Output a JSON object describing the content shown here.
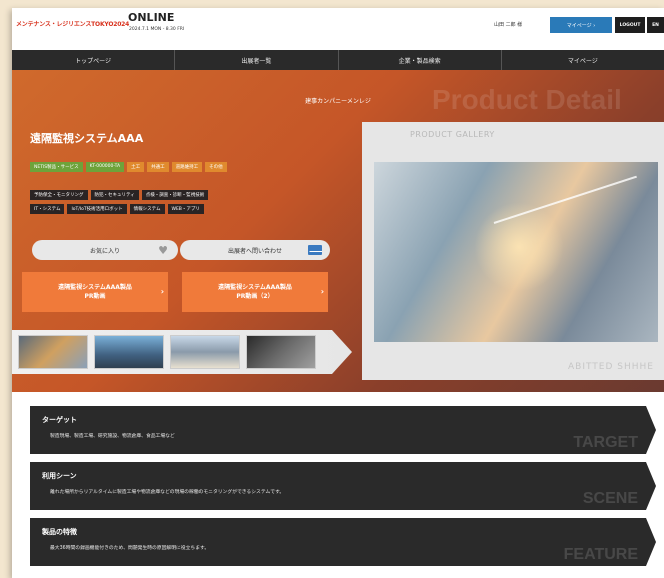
{
  "header": {
    "logo_blue": "メンテナンス・レジリエンスTOKYO2024",
    "online": "ONLINE",
    "date": "2024.7.1 MON - 8.30 FRI",
    "username": "山田 二郎 様",
    "mypage_label": "マイページ ›",
    "logout_label": "LOGOUT",
    "lang_label": "EN"
  },
  "nav": {
    "items": [
      {
        "label": "トップページ"
      },
      {
        "label": "出展者一覧"
      },
      {
        "label": "企業・製品検索"
      },
      {
        "label": "マイページ"
      }
    ]
  },
  "hero": {
    "watermark": "Product Detail",
    "company": "建事カンパニーメンレジ",
    "title": "遠隔監視システムAAA",
    "tags_row1": [
      {
        "label": "NETIS製品・サービス",
        "color": "green"
      },
      {
        "label": "KT-000000-TA",
        "color": "green"
      },
      {
        "label": "土工",
        "color": "orange"
      },
      {
        "label": "共通工",
        "color": "orange"
      },
      {
        "label": "道路維持工",
        "color": "orange"
      },
      {
        "label": "その他",
        "color": "orange"
      }
    ],
    "tags_row2": [
      "予防保全・モニタリング",
      "防犯・セキュリティ",
      "点検・調査・診断・監視技術"
    ],
    "tags_row3": [
      "IT・システム",
      "IoT/IoT技術活用ロボット",
      "情報システム",
      "WEB・アプリ"
    ],
    "fav_label": "お気に入り",
    "contact_label": "出展者へ問い合わせ",
    "pr1_line1": "遠隔監視システムAAA製品",
    "pr1_line2": "PR動画",
    "pr2_line1": "遠隔監視システムAAA製品",
    "pr2_line2": "PR動画（2）",
    "gallery_label": "PRODUCT GALLERY",
    "gallery_footer": "ABITTED SHHHE"
  },
  "sections": [
    {
      "title": "ターゲット",
      "text": "製造現場、製造工場、研究施設、物流倉庫、食品工場など",
      "watermark": "TARGET"
    },
    {
      "title": "利用シーン",
      "text": "離れた場所からリアルタイムに製造工場や物流倉庫などの現場の稼働のモニタリングができるシステムです。",
      "watermark": "SCENE"
    },
    {
      "title": "製品の特徴",
      "text": "最大36時間の録画機能付きのため、問題発生時の原因解明に役立ちます。",
      "watermark": "FEATURE"
    }
  ],
  "colors": {
    "background": "#f3e6cf",
    "hero_orange": "#c55628",
    "nav_dark": "#2a2a2a",
    "mypage_blue": "#2a7ab8",
    "pr_orange": "#f07a3a",
    "tag_green": "#6ea33a",
    "tag_orange": "#e08a2e",
    "mail_blue": "#3a7ac0"
  },
  "icons": {
    "heart": "heart-icon",
    "mail": "mail-icon",
    "chevron": "chevron-right-icon"
  }
}
